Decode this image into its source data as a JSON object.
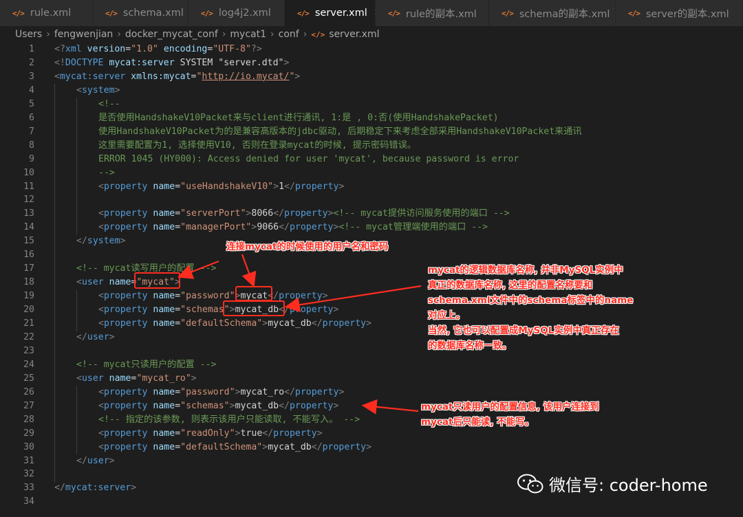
{
  "tabs": [
    {
      "label": "rule.xml",
      "active": false
    },
    {
      "label": "schema.xml",
      "active": false
    },
    {
      "label": "log4j2.xml",
      "active": false
    },
    {
      "label": "server.xml",
      "active": true
    },
    {
      "label": "rule的副本.xml",
      "active": false
    },
    {
      "label": "schema的副本.xml",
      "active": false
    },
    {
      "label": "server的副本.xml",
      "active": false
    }
  ],
  "file_icon": "</>",
  "close_glyph": "✕",
  "breadcrumb": [
    "Users",
    "fengwenjian",
    "docker_mycat_conf",
    "mycat1",
    "conf",
    "server.xml"
  ],
  "lines": [
    {
      "n": "1",
      "indent": 0,
      "tokens": [
        [
          "punct",
          "<?"
        ],
        [
          "tag",
          "xml"
        ],
        [
          "attr",
          " version"
        ],
        [
          "text",
          "="
        ],
        [
          "str",
          "\"1.0\""
        ],
        [
          "attr",
          " encoding"
        ],
        [
          "text",
          "="
        ],
        [
          "str",
          "\"UTF-8\""
        ],
        [
          "punct",
          "?>"
        ]
      ]
    },
    {
      "n": "2",
      "indent": 0,
      "tokens": [
        [
          "punct",
          "<!"
        ],
        [
          "tag",
          "DOCTYPE"
        ],
        [
          "attr",
          " mycat:server"
        ],
        [
          "text",
          " SYSTEM "
        ],
        [
          "text",
          "\"server.dtd\""
        ],
        [
          "punct",
          ">"
        ]
      ]
    },
    {
      "n": "3",
      "indent": 0,
      "tokens": [
        [
          "punct",
          "<"
        ],
        [
          "tag",
          "mycat:server"
        ],
        [
          "attr",
          " xmlns:mycat"
        ],
        [
          "text",
          "="
        ],
        [
          "str",
          "\""
        ],
        [
          "link",
          "http://io.mycat/"
        ],
        [
          "str",
          "\""
        ],
        [
          "punct",
          ">"
        ]
      ]
    },
    {
      "n": "4",
      "indent": 1,
      "tokens": [
        [
          "punct",
          "<"
        ],
        [
          "tag",
          "system"
        ],
        [
          "punct",
          ">"
        ]
      ]
    },
    {
      "n": "5",
      "indent": 2,
      "tokens": [
        [
          "com",
          "<!--"
        ]
      ]
    },
    {
      "n": "6",
      "indent": 2,
      "tokens": [
        [
          "com",
          "是否使用HandshakeV10Packet来与client进行通讯, 1:是 , 0:否(使用HandshakePacket)"
        ]
      ]
    },
    {
      "n": "7",
      "indent": 2,
      "tokens": [
        [
          "com",
          "使用HandshakeV10Packet为的是兼容高版本的jdbc驱动, 后期稳定下来考虑全部采用HandshakeV10Packet来通讯"
        ]
      ]
    },
    {
      "n": "8",
      "indent": 2,
      "tokens": [
        [
          "com",
          "这里需要配置为1, 选择使用V10, 否则在登录mycat的时候, 提示密码错误。"
        ]
      ]
    },
    {
      "n": "9",
      "indent": 2,
      "tokens": [
        [
          "com",
          "ERROR 1045 (HY000): Access denied for user 'mycat', because password is error"
        ]
      ]
    },
    {
      "n": "10",
      "indent": 2,
      "tokens": [
        [
          "com",
          "-->"
        ]
      ]
    },
    {
      "n": "11",
      "indent": 2,
      "tokens": [
        [
          "punct",
          "<"
        ],
        [
          "tag",
          "property"
        ],
        [
          "attr",
          " name"
        ],
        [
          "text",
          "="
        ],
        [
          "str",
          "\"useHandshakeV10\""
        ],
        [
          "punct",
          ">"
        ],
        [
          "text",
          "1"
        ],
        [
          "punct",
          "</"
        ],
        [
          "tag",
          "property"
        ],
        [
          "punct",
          ">"
        ]
      ]
    },
    {
      "n": "12",
      "indent": 2,
      "tokens": []
    },
    {
      "n": "13",
      "indent": 2,
      "tokens": [
        [
          "punct",
          "<"
        ],
        [
          "tag",
          "property"
        ],
        [
          "attr",
          " name"
        ],
        [
          "text",
          "="
        ],
        [
          "str",
          "\"serverPort\""
        ],
        [
          "punct",
          ">"
        ],
        [
          "text",
          "8066"
        ],
        [
          "punct",
          "</"
        ],
        [
          "tag",
          "property"
        ],
        [
          "punct",
          ">"
        ],
        [
          "com",
          "<!-- mycat提供访问服务使用的端口 -->"
        ]
      ]
    },
    {
      "n": "14",
      "indent": 2,
      "tokens": [
        [
          "punct",
          "<"
        ],
        [
          "tag",
          "property"
        ],
        [
          "attr",
          " name"
        ],
        [
          "text",
          "="
        ],
        [
          "str",
          "\"managerPort\""
        ],
        [
          "punct",
          ">"
        ],
        [
          "text",
          "9066"
        ],
        [
          "punct",
          "</"
        ],
        [
          "tag",
          "property"
        ],
        [
          "punct",
          ">"
        ],
        [
          "com",
          "<!-- mycat管理端使用的端口 -->"
        ]
      ]
    },
    {
      "n": "15",
      "indent": 1,
      "tokens": [
        [
          "punct",
          "</"
        ],
        [
          "tag",
          "system"
        ],
        [
          "punct",
          ">"
        ]
      ]
    },
    {
      "n": "16",
      "indent": 1,
      "tokens": []
    },
    {
      "n": "17",
      "indent": 1,
      "tokens": [
        [
          "com",
          "<!-- mycat读写用户的配置 -->"
        ]
      ]
    },
    {
      "n": "18",
      "indent": 1,
      "tokens": [
        [
          "punct",
          "<"
        ],
        [
          "tag",
          "user"
        ],
        [
          "attr",
          " name"
        ],
        [
          "text",
          "="
        ],
        [
          "str",
          "\"mycat\""
        ],
        [
          "punct",
          ">"
        ]
      ]
    },
    {
      "n": "19",
      "indent": 2,
      "tokens": [
        [
          "punct",
          "<"
        ],
        [
          "tag",
          "property"
        ],
        [
          "attr",
          " name"
        ],
        [
          "text",
          "="
        ],
        [
          "str",
          "\"password\""
        ],
        [
          "punct",
          ">"
        ],
        [
          "text",
          "mycat"
        ],
        [
          "punct",
          "</"
        ],
        [
          "tag",
          "property"
        ],
        [
          "punct",
          ">"
        ]
      ]
    },
    {
      "n": "20",
      "indent": 2,
      "tokens": [
        [
          "punct",
          "<"
        ],
        [
          "tag",
          "property"
        ],
        [
          "attr",
          " name"
        ],
        [
          "text",
          "="
        ],
        [
          "str",
          "\"schemas\""
        ],
        [
          "punct",
          ">"
        ],
        [
          "text",
          "mycat_db"
        ],
        [
          "punct",
          "</"
        ],
        [
          "tag",
          "property"
        ],
        [
          "punct",
          ">"
        ]
      ]
    },
    {
      "n": "21",
      "indent": 2,
      "tokens": [
        [
          "punct",
          "<"
        ],
        [
          "tag",
          "property"
        ],
        [
          "attr",
          " name"
        ],
        [
          "text",
          "="
        ],
        [
          "str",
          "\"defaultSchema\""
        ],
        [
          "punct",
          ">"
        ],
        [
          "text",
          "mycat_db"
        ],
        [
          "punct",
          "</"
        ],
        [
          "tag",
          "property"
        ],
        [
          "punct",
          ">"
        ]
      ]
    },
    {
      "n": "22",
      "indent": 1,
      "tokens": [
        [
          "punct",
          "</"
        ],
        [
          "tag",
          "user"
        ],
        [
          "punct",
          ">"
        ]
      ]
    },
    {
      "n": "23",
      "indent": 1,
      "tokens": []
    },
    {
      "n": "24",
      "indent": 1,
      "tokens": [
        [
          "com",
          "<!-- mycat只读用户的配置 -->"
        ]
      ]
    },
    {
      "n": "25",
      "indent": 1,
      "tokens": [
        [
          "punct",
          "<"
        ],
        [
          "tag",
          "user"
        ],
        [
          "attr",
          " name"
        ],
        [
          "text",
          "="
        ],
        [
          "str",
          "\"mycat_ro\""
        ],
        [
          "punct",
          ">"
        ]
      ]
    },
    {
      "n": "26",
      "indent": 2,
      "tokens": [
        [
          "punct",
          "<"
        ],
        [
          "tag",
          "property"
        ],
        [
          "attr",
          " name"
        ],
        [
          "text",
          "="
        ],
        [
          "str",
          "\"password\""
        ],
        [
          "punct",
          ">"
        ],
        [
          "text",
          "mycat_ro"
        ],
        [
          "punct",
          "</"
        ],
        [
          "tag",
          "property"
        ],
        [
          "punct",
          ">"
        ]
      ]
    },
    {
      "n": "27",
      "indent": 2,
      "tokens": [
        [
          "punct",
          "<"
        ],
        [
          "tag",
          "property"
        ],
        [
          "attr",
          " name"
        ],
        [
          "text",
          "="
        ],
        [
          "str",
          "\"schemas\""
        ],
        [
          "punct",
          ">"
        ],
        [
          "text",
          "mycat_db"
        ],
        [
          "punct",
          "</"
        ],
        [
          "tag",
          "property"
        ],
        [
          "punct",
          ">"
        ]
      ]
    },
    {
      "n": "28",
      "indent": 2,
      "tokens": [
        [
          "com",
          "<!-- 指定的该参数, 则表示该用户只能读取, 不能写入。 -->"
        ]
      ]
    },
    {
      "n": "29",
      "indent": 2,
      "tokens": [
        [
          "punct",
          "<"
        ],
        [
          "tag",
          "property"
        ],
        [
          "attr",
          " name"
        ],
        [
          "text",
          "="
        ],
        [
          "str",
          "\"readOnly\""
        ],
        [
          "punct",
          ">"
        ],
        [
          "text",
          "true"
        ],
        [
          "punct",
          "</"
        ],
        [
          "tag",
          "property"
        ],
        [
          "punct",
          ">"
        ]
      ]
    },
    {
      "n": "30",
      "indent": 2,
      "tokens": [
        [
          "punct",
          "<"
        ],
        [
          "tag",
          "property"
        ],
        [
          "attr",
          " name"
        ],
        [
          "text",
          "="
        ],
        [
          "str",
          "\"defaultSchema\""
        ],
        [
          "punct",
          ">"
        ],
        [
          "text",
          "mycat_db"
        ],
        [
          "punct",
          "</"
        ],
        [
          "tag",
          "property"
        ],
        [
          "punct",
          ">"
        ]
      ]
    },
    {
      "n": "31",
      "indent": 1,
      "tokens": [
        [
          "punct",
          "</"
        ],
        [
          "tag",
          "user"
        ],
        [
          "punct",
          ">"
        ]
      ]
    },
    {
      "n": "32",
      "indent": 0,
      "tokens": []
    },
    {
      "n": "33",
      "indent": 0,
      "tokens": [
        [
          "punct",
          "</"
        ],
        [
          "tag",
          "mycat:server"
        ],
        [
          "punct",
          ">"
        ]
      ]
    },
    {
      "n": "34",
      "indent": 0,
      "tokens": []
    }
  ],
  "annotations": {
    "login": "连接mycat的时候使用的用户名和密码",
    "logical_db": [
      "mycat的逻辑数据库名称, 并非MySQL实例中",
      "真正的数据库名称, 这里的配置名称要和",
      "schema.xml文件中的schema标签中的name",
      "对应上。",
      "当然, 它也可以配置成MySQL实例中真正存在",
      "的数据库名称一致。"
    ],
    "readonly": [
      "mycat只读用户的配置信息, 该用户连接到",
      "mycat后只能读, 不能写。"
    ]
  },
  "watermark": {
    "text": "微信号: coder-home",
    "icon": "wechat-icon"
  },
  "colors": {
    "annotation": "#ff2d20",
    "tag": "#569cd6",
    "attr": "#9cdcfe",
    "string": "#ce9178",
    "comment": "#6a9955",
    "file_icon": "#e37933"
  }
}
